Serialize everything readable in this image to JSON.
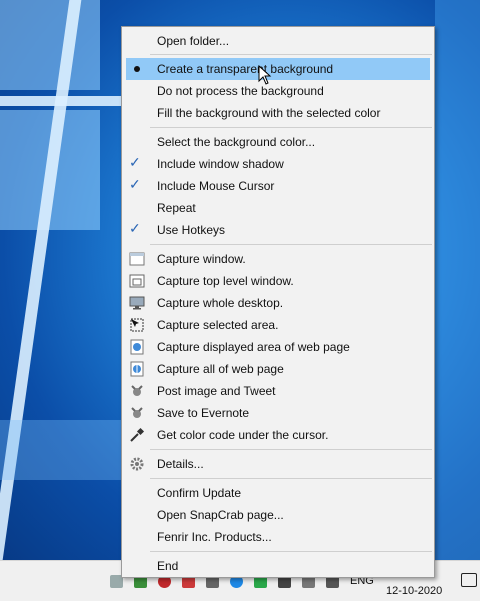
{
  "menu": {
    "items": [
      {
        "label": "Open folder...",
        "mark": "none",
        "icon": null
      },
      {
        "label": "Create a transparent background",
        "mark": "radio",
        "icon": null,
        "highlighted": true
      },
      {
        "label": "Do not process the background",
        "mark": "none",
        "icon": null
      },
      {
        "label": "Fill the background with the selected color",
        "mark": "none",
        "icon": null
      },
      {
        "label": "Select the background color...",
        "mark": "none",
        "icon": null
      },
      {
        "label": "Include window shadow",
        "mark": "check",
        "icon": null
      },
      {
        "label": "Include Mouse Cursor",
        "mark": "check",
        "icon": null
      },
      {
        "label": "Repeat",
        "mark": "none",
        "icon": null
      },
      {
        "label": "Use Hotkeys",
        "mark": "check",
        "icon": null
      },
      {
        "label": "Capture window.",
        "mark": "none",
        "icon": "window-icon"
      },
      {
        "label": "Capture top level window.",
        "mark": "none",
        "icon": "top-level-window-icon"
      },
      {
        "label": "Capture whole desktop.",
        "mark": "none",
        "icon": "desktop-monitor-icon"
      },
      {
        "label": "Capture selected area.",
        "mark": "none",
        "icon": "selection-area-icon"
      },
      {
        "label": "Capture displayed area of web page",
        "mark": "none",
        "icon": "web-page-icon"
      },
      {
        "label": "Capture all of web page",
        "mark": "none",
        "icon": "full-web-page-icon"
      },
      {
        "label": "Post image and Tweet",
        "mark": "none",
        "icon": "crab-tweet-icon"
      },
      {
        "label": "Save to Evernote",
        "mark": "none",
        "icon": "crab-evernote-icon"
      },
      {
        "label": "Get color code under the cursor.",
        "mark": "none",
        "icon": "eyedropper-icon"
      },
      {
        "label": "Details...",
        "mark": "none",
        "icon": "gear-icon"
      },
      {
        "label": "Confirm Update",
        "mark": "none",
        "icon": null
      },
      {
        "label": "Open SnapCrab page...",
        "mark": "none",
        "icon": null
      },
      {
        "label": "Fenrir Inc. Products...",
        "mark": "none",
        "icon": null
      },
      {
        "label": "End",
        "mark": "none",
        "icon": null
      }
    ],
    "check_glyph": "✓"
  },
  "taskbar": {
    "language": "ENG",
    "date": "12-10-2020"
  },
  "colors": {
    "highlight": "#91c9f7",
    "check": "#2a66b5",
    "desktop": "#1f7fd6"
  }
}
